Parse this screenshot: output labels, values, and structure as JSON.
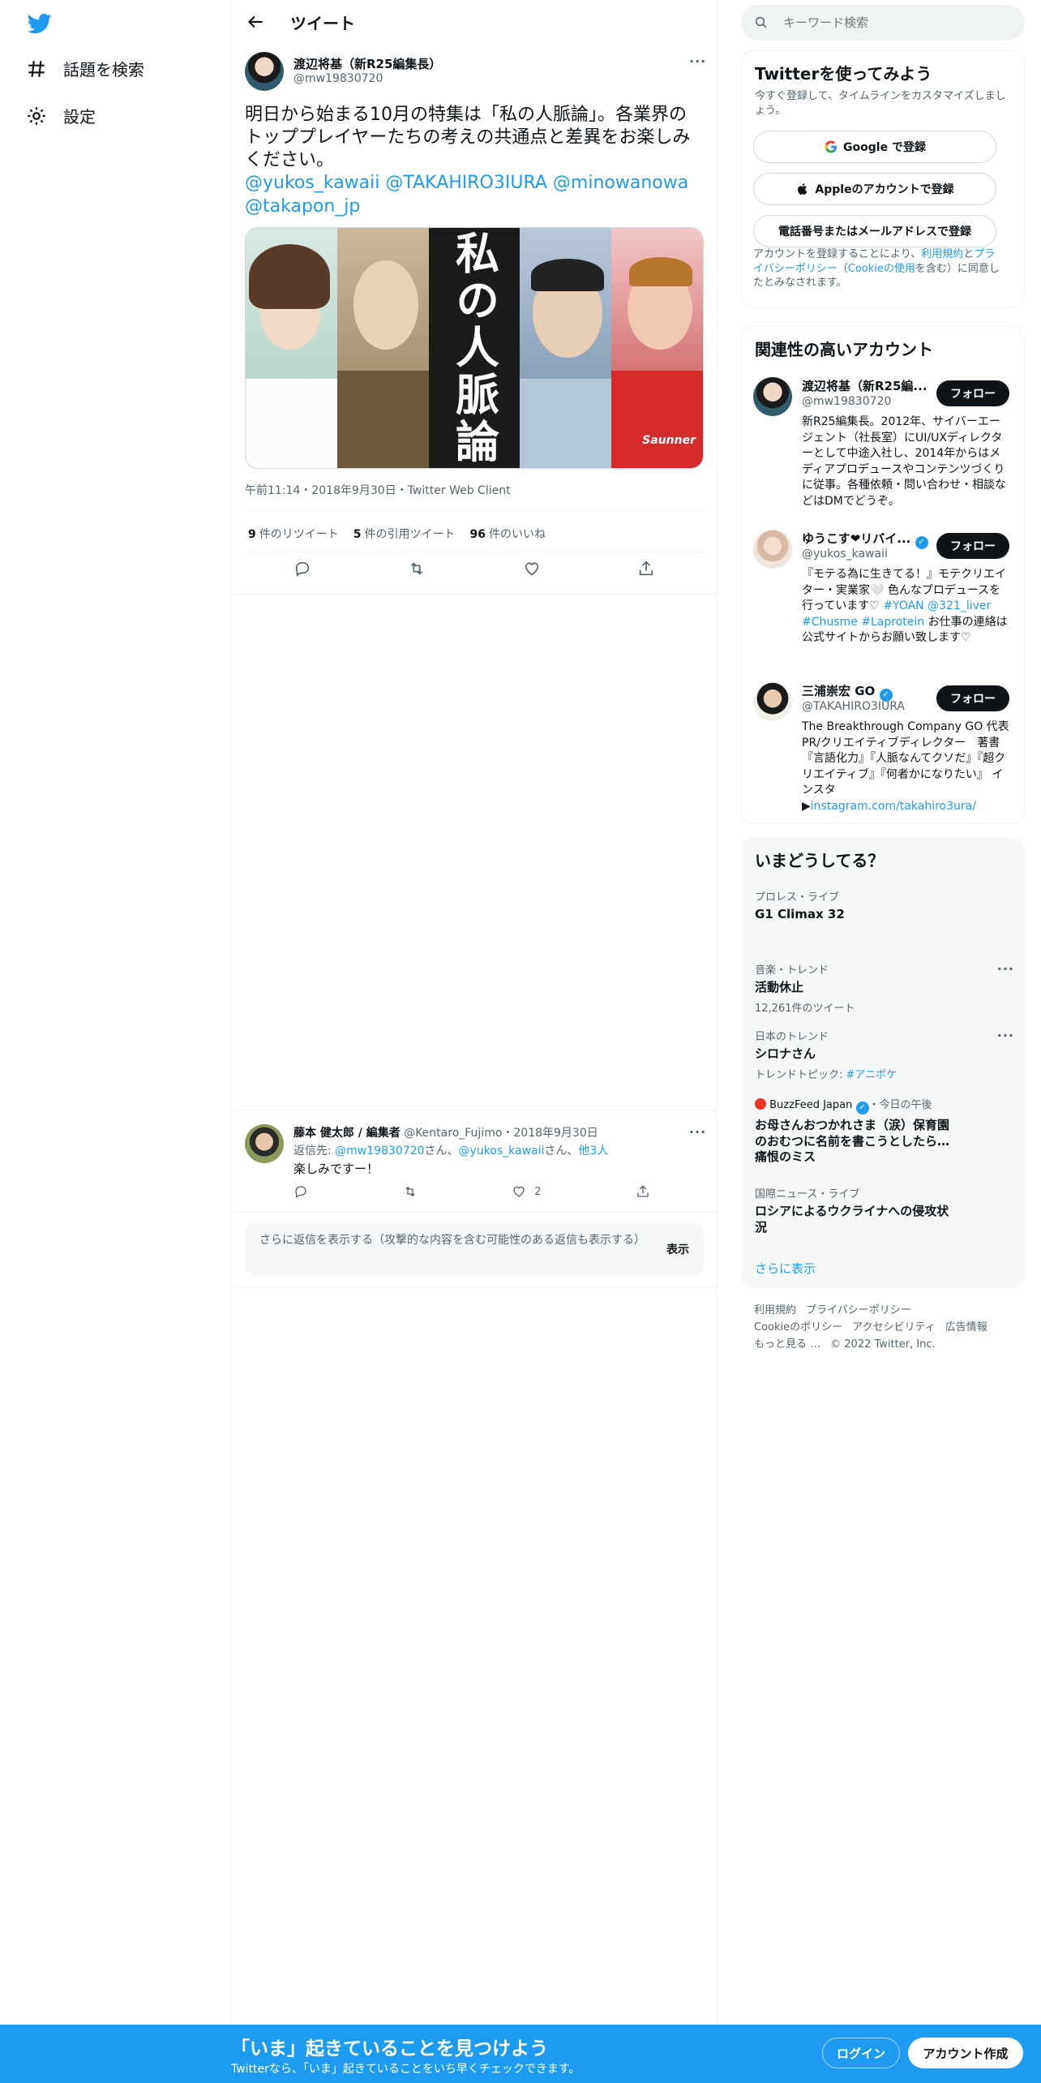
{
  "nav": {
    "logo": "twitter-bird",
    "items": [
      {
        "label": "話題を検索",
        "icon": "hashtag-icon"
      },
      {
        "label": "設定",
        "icon": "gear-icon"
      }
    ]
  },
  "header": {
    "title": "ツイート"
  },
  "tweet": {
    "author_name": "渡辺将基（新R25編集長）",
    "author_handle": "@mw19830720",
    "text": "明日から始まる10月の特集は「私の人脈論」。各業界のトッププレイヤーたちの考えの共通点と差異をお楽しみください。",
    "mentions_line1": "@yukos_kawaii @TAKAHIRO3IURA @minowanowa",
    "mentions_line2": "@takapon_jp",
    "image_title": "私の人脈論",
    "image_shirt_text": "Saunner",
    "timestamp": "午前11:14・2018年9月30日・Twitter Web Client",
    "stats": {
      "retweets_count": "9",
      "retweets_label": "件のリツイート",
      "quotes_count": "5",
      "quotes_label": "件の引用ツイート",
      "likes_count": "96",
      "likes_label": "件のいいね"
    }
  },
  "reply": {
    "author_name": "藤本 健太郎 / 編集者",
    "author_meta": "@Kentaro_Fujimo・2018年9月30日",
    "reply_prefix": "返信先: ",
    "reply_to_1": "@mw19830720",
    "reply_sep_1": "さん、",
    "reply_to_2": "@yukos_kawaii",
    "reply_sep_2": "さん、",
    "reply_more": "他3人",
    "text": "楽しみですー！",
    "likes": "2"
  },
  "show_more": {
    "text": "さらに返信を表示する（攻撃的な内容を含む可能性のある返信も表示する）",
    "button": "表示"
  },
  "sidebar": {
    "search_placeholder": "キーワード検索",
    "signup": {
      "title": "Twitterを使ってみよう",
      "subtitle": "今すぐ登録して、タイムラインをカスタマイズしましょう。",
      "google": "Google で登録",
      "apple": "Appleのアカウントで登録",
      "phone": "電話番号またはメールアドレスで登録",
      "legal_1": "アカウントを登録することにより、",
      "legal_link_1": "利用規約",
      "legal_2": "と",
      "legal_link_2": "プライバシーポリシー",
      "legal_3": "（",
      "legal_link_3": "Cookieの使用",
      "legal_4": "を含む）に同意したとみなされます。"
    },
    "relevant": {
      "title": "関連性の高いアカウント",
      "follow_label": "フォロー",
      "accounts": [
        {
          "name": "渡辺将基（新R25編...",
          "handle": "@mw19830720",
          "bio": "新R25編集長。2012年、サイバーエージェント（社長室）にUI/UXディレクターとして中途入社し、2014年からはメディアプロデュースやコンテンツづくりに従事。各種依頼・問い合わせ・相談などはDMでどうぞ。"
        },
        {
          "name": "ゆうこす❤リバイ...",
          "handle": "@yukos_kawaii",
          "bio_1": "『モテる為に生きてる！』モテクリエイター・実業家🤍 色んなプロデュースを行っています♡ ",
          "bio_tag_1": "#YOAN",
          "bio_tag_2": "@321_liver",
          "bio_tag_3": "#Chusme",
          "bio_tag_4": "#Laprotein",
          "bio_2": " お仕事の連絡は公式サイトからお願い致します♡"
        },
        {
          "name": "三浦崇宏 GO",
          "handle": "@TAKAHIRO3IURA",
          "bio_1": "The Breakthrough Company GO 代表 PR/クリエイティブディレクター　著書『言語化力』『人脈なんてクソだ』『超クリエイティブ』『何者かになりたい』 インスタ ▶",
          "bio_link": "instagram.com/takahiro3ura/"
        }
      ]
    },
    "trends": {
      "title": "いまどうしてる？",
      "items": [
        {
          "category": "プロレス・ライブ",
          "title": "G1 Climax 32",
          "sub": ""
        },
        {
          "category": "音楽・トレンド",
          "title": "活動休止",
          "sub": "12,261件のツイート"
        },
        {
          "category": "日本のトレンド",
          "title": "シロナさん",
          "sub_prefix": "トレンドトピック: ",
          "sub_link": "#アニポケ"
        },
        {
          "source": "BuzzFeed Japan",
          "time": "・今日の午後",
          "title": "お母さんおつかれさま（涙）保育園のおむつに名前を書こうとしたら…痛恨のミス"
        },
        {
          "category": "国際ニュース・ライブ",
          "title": "ロシアによるウクライナへの侵攻状況"
        }
      ],
      "show_more": "さらに表示"
    },
    "footer": {
      "links": [
        "利用規約",
        "プライバシーポリシー",
        "Cookieのポリシー",
        "アクセシビリティ",
        "広告情報",
        "もっと見る …"
      ],
      "copyright": "© 2022 Twitter, Inc."
    }
  },
  "bottom_bar": {
    "headline": "「いま」起きていることを見つけよう",
    "sub": "Twitterなら、「いま」起きていることをいち早くチェックできます。",
    "login": "ログイン",
    "signup": "アカウント作成"
  },
  "colors": {
    "accent": "#1d9bf0",
    "text": "#0f1419",
    "secondary": "#536471"
  }
}
